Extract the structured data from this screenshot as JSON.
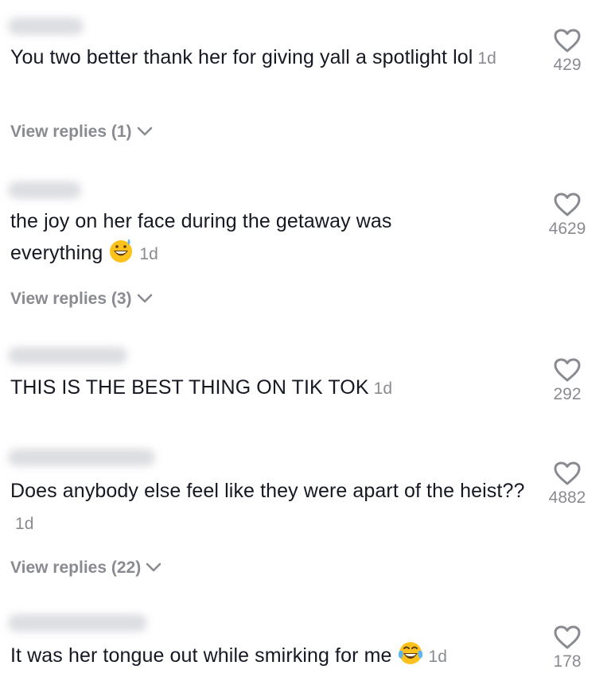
{
  "comments": [
    {
      "text": "You two better thank her for giving yall a spotlight lol",
      "time": "1d",
      "likes": "429",
      "replies": "View replies (1)"
    },
    {
      "text": "the joy on her face during the getaway was everything",
      "time": "1d",
      "likes": "4629",
      "replies": "View replies (3)",
      "emoji": "grinning-sweat-emoji"
    },
    {
      "text": "THIS IS THE BEST THING ON TIK TOK",
      "time": "1d",
      "likes": "292"
    },
    {
      "text": "Does anybody else feel like they were apart of the heist??",
      "time": "1d",
      "likes": "4882",
      "replies": "View replies (22)"
    },
    {
      "text": "It was her tongue out while smirking for me",
      "time": "1d",
      "likes": "178",
      "emoji": "tears-of-joy-emoji"
    }
  ],
  "icons": {
    "like": "heart-outline-icon",
    "expand": "chevron-down-icon"
  },
  "colors": {
    "text": "#161823",
    "secondary": "#8a8b91"
  }
}
